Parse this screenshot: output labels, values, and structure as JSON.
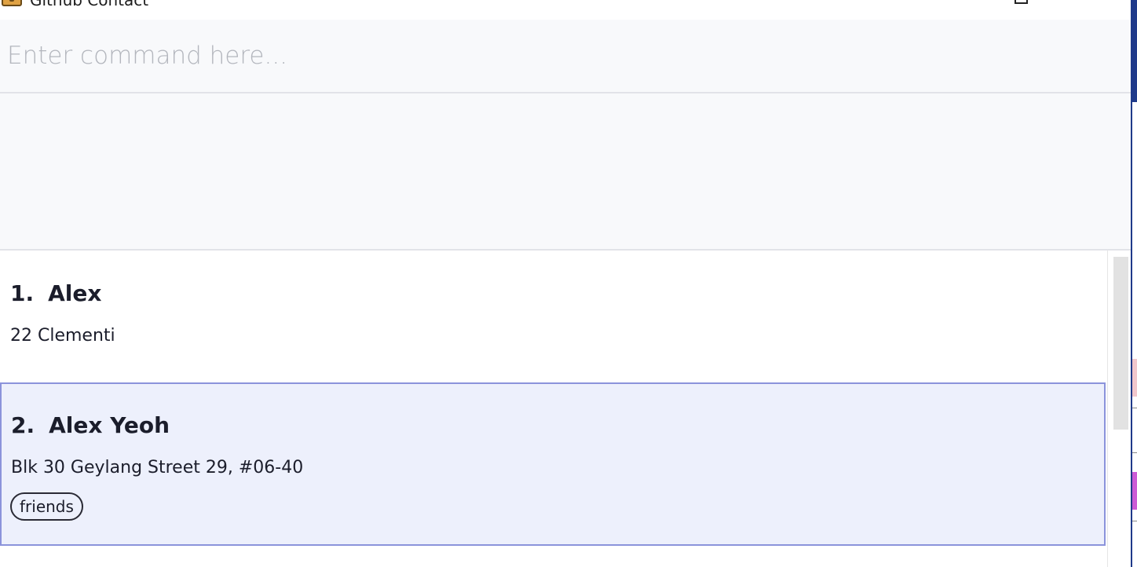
{
  "window": {
    "title": "Github Contact"
  },
  "command_box": {
    "placeholder": "Enter command here...",
    "value": ""
  },
  "result_display": {
    "text": ""
  },
  "person_list": {
    "items": [
      {
        "index": "1.",
        "name": "Alex",
        "address": "22 Clementi",
        "tags": [],
        "selected": false
      },
      {
        "index": "2.",
        "name": "Alex Yeoh",
        "address": "Blk 30 Geylang Street 29, #06-40",
        "tags": [
          "friends"
        ],
        "selected": true
      }
    ]
  },
  "colors": {
    "selected_card_bg": "#edf0fc",
    "selected_card_border": "#8b93db",
    "panel_bg": "#f8f9fb"
  },
  "icons": {
    "app": "app-icon",
    "maximize": "maximize-icon",
    "close": "close-icon"
  }
}
